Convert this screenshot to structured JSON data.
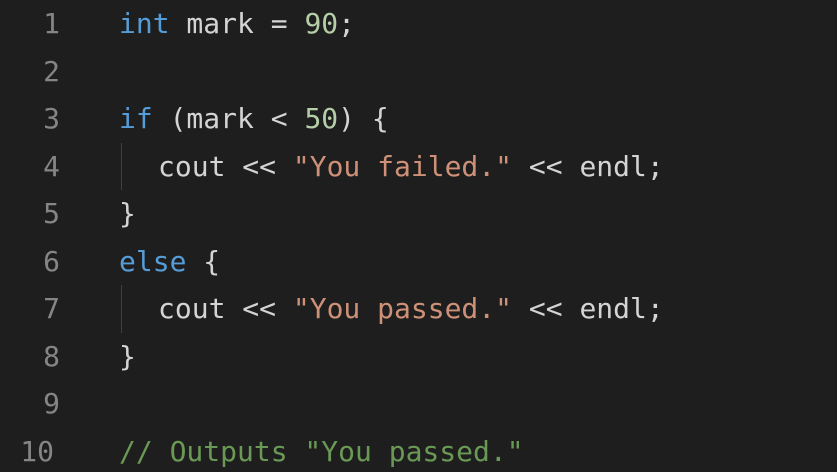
{
  "lines": [
    {
      "num": "1",
      "parts": [
        {
          "t": "int",
          "c": "kw"
        },
        {
          "t": " mark = ",
          "c": "txt"
        },
        {
          "t": "90",
          "c": "num"
        },
        {
          "t": ";",
          "c": "txt"
        }
      ]
    },
    {
      "num": "2",
      "parts": []
    },
    {
      "num": "3",
      "parts": [
        {
          "t": "if",
          "c": "kw"
        },
        {
          "t": " (mark < ",
          "c": "txt"
        },
        {
          "t": "50",
          "c": "num"
        },
        {
          "t": ") {",
          "c": "txt"
        }
      ]
    },
    {
      "num": "4",
      "parts": [
        {
          "t": "cout << ",
          "c": "txt"
        },
        {
          "t": "\"You failed.\"",
          "c": "str"
        },
        {
          "t": " << endl;",
          "c": "txt"
        }
      ]
    },
    {
      "num": "5",
      "parts": [
        {
          "t": "}",
          "c": "txt"
        }
      ]
    },
    {
      "num": "6",
      "parts": [
        {
          "t": "else",
          "c": "kw"
        },
        {
          "t": " {",
          "c": "txt"
        }
      ]
    },
    {
      "num": "7",
      "parts": [
        {
          "t": "cout << ",
          "c": "txt"
        },
        {
          "t": "\"You passed.\"",
          "c": "str"
        },
        {
          "t": " << endl;",
          "c": "txt"
        }
      ]
    },
    {
      "num": "8",
      "parts": [
        {
          "t": "}",
          "c": "txt"
        }
      ]
    },
    {
      "num": "9",
      "parts": []
    },
    {
      "num": "10",
      "parts": [
        {
          "t": "// Outputs \"You passed.\"",
          "c": "cmt"
        }
      ]
    }
  ],
  "colors": {
    "background": "#1e1e1e",
    "line_number": "#858585",
    "keyword": "#569cd6",
    "number": "#b5cea8",
    "string": "#ce9178",
    "comment": "#6a9955",
    "text": "#d4d4d4"
  }
}
